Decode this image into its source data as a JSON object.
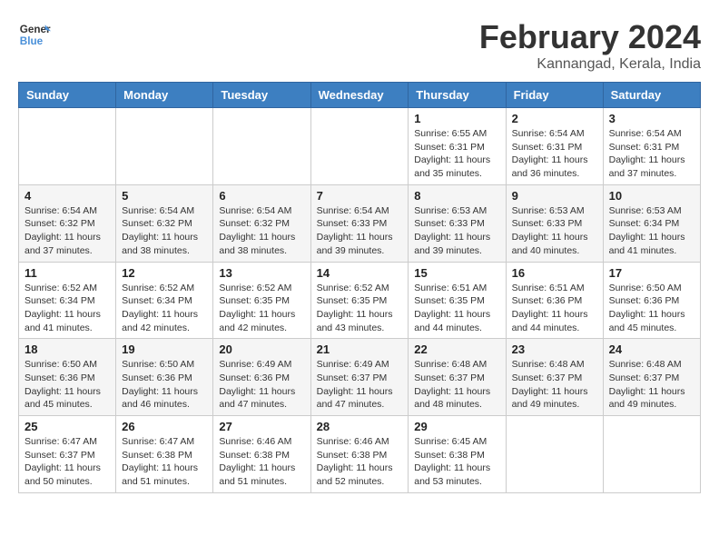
{
  "header": {
    "logo_line1": "General",
    "logo_line2": "Blue",
    "month": "February 2024",
    "location": "Kannangad, Kerala, India"
  },
  "weekdays": [
    "Sunday",
    "Monday",
    "Tuesday",
    "Wednesday",
    "Thursday",
    "Friday",
    "Saturday"
  ],
  "weeks": [
    [
      {
        "day": "",
        "info": ""
      },
      {
        "day": "",
        "info": ""
      },
      {
        "day": "",
        "info": ""
      },
      {
        "day": "",
        "info": ""
      },
      {
        "day": "1",
        "info": "Sunrise: 6:55 AM\nSunset: 6:31 PM\nDaylight: 11 hours\nand 35 minutes."
      },
      {
        "day": "2",
        "info": "Sunrise: 6:54 AM\nSunset: 6:31 PM\nDaylight: 11 hours\nand 36 minutes."
      },
      {
        "day": "3",
        "info": "Sunrise: 6:54 AM\nSunset: 6:31 PM\nDaylight: 11 hours\nand 37 minutes."
      }
    ],
    [
      {
        "day": "4",
        "info": "Sunrise: 6:54 AM\nSunset: 6:32 PM\nDaylight: 11 hours\nand 37 minutes."
      },
      {
        "day": "5",
        "info": "Sunrise: 6:54 AM\nSunset: 6:32 PM\nDaylight: 11 hours\nand 38 minutes."
      },
      {
        "day": "6",
        "info": "Sunrise: 6:54 AM\nSunset: 6:32 PM\nDaylight: 11 hours\nand 38 minutes."
      },
      {
        "day": "7",
        "info": "Sunrise: 6:54 AM\nSunset: 6:33 PM\nDaylight: 11 hours\nand 39 minutes."
      },
      {
        "day": "8",
        "info": "Sunrise: 6:53 AM\nSunset: 6:33 PM\nDaylight: 11 hours\nand 39 minutes."
      },
      {
        "day": "9",
        "info": "Sunrise: 6:53 AM\nSunset: 6:33 PM\nDaylight: 11 hours\nand 40 minutes."
      },
      {
        "day": "10",
        "info": "Sunrise: 6:53 AM\nSunset: 6:34 PM\nDaylight: 11 hours\nand 41 minutes."
      }
    ],
    [
      {
        "day": "11",
        "info": "Sunrise: 6:52 AM\nSunset: 6:34 PM\nDaylight: 11 hours\nand 41 minutes."
      },
      {
        "day": "12",
        "info": "Sunrise: 6:52 AM\nSunset: 6:34 PM\nDaylight: 11 hours\nand 42 minutes."
      },
      {
        "day": "13",
        "info": "Sunrise: 6:52 AM\nSunset: 6:35 PM\nDaylight: 11 hours\nand 42 minutes."
      },
      {
        "day": "14",
        "info": "Sunrise: 6:52 AM\nSunset: 6:35 PM\nDaylight: 11 hours\nand 43 minutes."
      },
      {
        "day": "15",
        "info": "Sunrise: 6:51 AM\nSunset: 6:35 PM\nDaylight: 11 hours\nand 44 minutes."
      },
      {
        "day": "16",
        "info": "Sunrise: 6:51 AM\nSunset: 6:36 PM\nDaylight: 11 hours\nand 44 minutes."
      },
      {
        "day": "17",
        "info": "Sunrise: 6:50 AM\nSunset: 6:36 PM\nDaylight: 11 hours\nand 45 minutes."
      }
    ],
    [
      {
        "day": "18",
        "info": "Sunrise: 6:50 AM\nSunset: 6:36 PM\nDaylight: 11 hours\nand 45 minutes."
      },
      {
        "day": "19",
        "info": "Sunrise: 6:50 AM\nSunset: 6:36 PM\nDaylight: 11 hours\nand 46 minutes."
      },
      {
        "day": "20",
        "info": "Sunrise: 6:49 AM\nSunset: 6:36 PM\nDaylight: 11 hours\nand 47 minutes."
      },
      {
        "day": "21",
        "info": "Sunrise: 6:49 AM\nSunset: 6:37 PM\nDaylight: 11 hours\nand 47 minutes."
      },
      {
        "day": "22",
        "info": "Sunrise: 6:48 AM\nSunset: 6:37 PM\nDaylight: 11 hours\nand 48 minutes."
      },
      {
        "day": "23",
        "info": "Sunrise: 6:48 AM\nSunset: 6:37 PM\nDaylight: 11 hours\nand 49 minutes."
      },
      {
        "day": "24",
        "info": "Sunrise: 6:48 AM\nSunset: 6:37 PM\nDaylight: 11 hours\nand 49 minutes."
      }
    ],
    [
      {
        "day": "25",
        "info": "Sunrise: 6:47 AM\nSunset: 6:37 PM\nDaylight: 11 hours\nand 50 minutes."
      },
      {
        "day": "26",
        "info": "Sunrise: 6:47 AM\nSunset: 6:38 PM\nDaylight: 11 hours\nand 51 minutes."
      },
      {
        "day": "27",
        "info": "Sunrise: 6:46 AM\nSunset: 6:38 PM\nDaylight: 11 hours\nand 51 minutes."
      },
      {
        "day": "28",
        "info": "Sunrise: 6:46 AM\nSunset: 6:38 PM\nDaylight: 11 hours\nand 52 minutes."
      },
      {
        "day": "29",
        "info": "Sunrise: 6:45 AM\nSunset: 6:38 PM\nDaylight: 11 hours\nand 53 minutes."
      },
      {
        "day": "",
        "info": ""
      },
      {
        "day": "",
        "info": ""
      }
    ]
  ]
}
